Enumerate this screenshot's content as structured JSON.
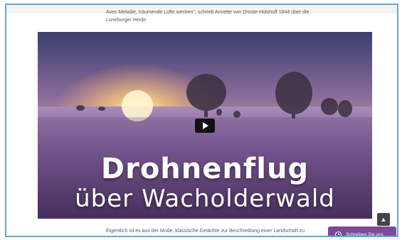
{
  "article": {
    "intro_text": "Aves Melodie, träumende Lüfte wecken\", schrieb Annette von Droste-Hülshoff 1844 über die Lüneburger Heide.",
    "body_text": "Eigentlich ist es aus der Mode, klassische Gedichte zur Beschreibung einer Landschaft zu nutzen..."
  },
  "video": {
    "title_line1": "Drohnenflug",
    "title_line2": "über Wacholderwald",
    "play_icon": "play-icon"
  },
  "widgets": {
    "contact_label": "Schreiben Sie uns",
    "contact_icon": "clock-icon",
    "scroll_top_icon": "chevron-up-icon"
  },
  "colors": {
    "frame_border": "#6aa7cf",
    "contact_bg": "#7c4a98"
  }
}
